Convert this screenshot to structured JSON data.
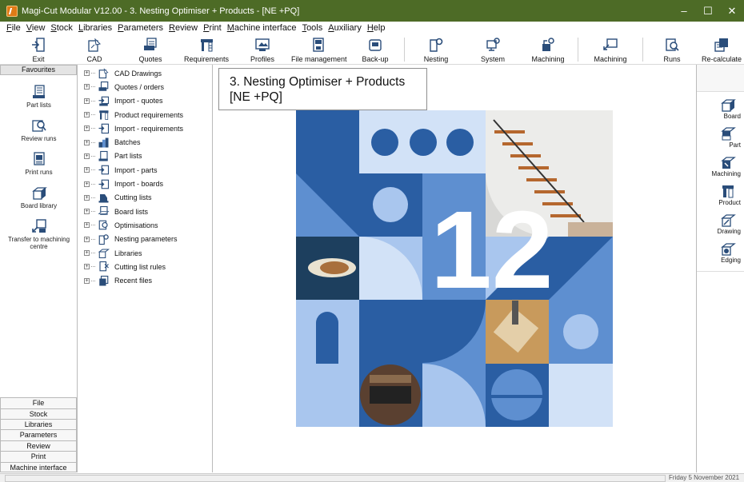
{
  "window": {
    "title": "Magi-Cut Modular V12.00 - 3. Nesting Optimiser + Products - [NE +PQ]",
    "controls": [
      "–",
      "☐",
      "✕"
    ]
  },
  "menu": [
    "File",
    "View",
    "Stock",
    "Libraries",
    "Parameters",
    "Review",
    "Print",
    "Machine interface",
    "Tools",
    "Auxiliary",
    "Help"
  ],
  "toolbar": [
    {
      "label": "Exit",
      "icon": "exit-door-icon"
    },
    {
      "label": "CAD",
      "icon": "cad-icon"
    },
    {
      "label": "Quotes",
      "icon": "quotes-icon"
    },
    {
      "label": "Requirements",
      "icon": "requirements-icon"
    },
    {
      "label": "Profiles",
      "icon": "profiles-icon"
    },
    {
      "label": "File management",
      "icon": "file-management-icon"
    },
    {
      "label": "Back-up",
      "icon": "backup-icon"
    },
    {
      "label": "Nesting",
      "icon": "nesting-icon"
    },
    {
      "label": "System",
      "icon": "system-icon"
    },
    {
      "label": "Machining",
      "icon": "machining-icon"
    },
    {
      "label": "Machining",
      "icon": "machining-icon"
    },
    {
      "label": "Runs",
      "icon": "runs-icon"
    },
    {
      "label": "Re-calculate",
      "icon": "recalculate-icon"
    }
  ],
  "favourites": {
    "header": "Favourites",
    "items": [
      {
        "label": "Part lists",
        "icon": "part-lists-icon"
      },
      {
        "label": "Review runs",
        "icon": "review-runs-icon"
      },
      {
        "label": "Print runs",
        "icon": "print-runs-icon"
      },
      {
        "label": "Board library",
        "icon": "board-library-icon"
      },
      {
        "label": "Transfer to machining centre",
        "icon": "transfer-icon"
      }
    ]
  },
  "bottom_buttons": [
    "File",
    "Stock",
    "Libraries",
    "Parameters",
    "Review",
    "Print",
    "Machine interface"
  ],
  "tree": [
    {
      "label": "CAD Drawings",
      "icon": "cad-drawings-icon"
    },
    {
      "label": "Quotes / orders",
      "icon": "quotes-orders-icon"
    },
    {
      "label": "Import - quotes",
      "icon": "import-quotes-icon"
    },
    {
      "label": "Product requirements",
      "icon": "product-requirements-icon"
    },
    {
      "label": "Import - requirements",
      "icon": "import-requirements-icon"
    },
    {
      "label": "Batches",
      "icon": "batches-icon"
    },
    {
      "label": "Part lists",
      "icon": "part-lists-icon"
    },
    {
      "label": "Import - parts",
      "icon": "import-parts-icon"
    },
    {
      "label": "Import - boards",
      "icon": "import-boards-icon"
    },
    {
      "label": "Cutting lists",
      "icon": "cutting-lists-icon"
    },
    {
      "label": "Board lists",
      "icon": "board-lists-icon"
    },
    {
      "label": "Optimisations",
      "icon": "optimisations-icon"
    },
    {
      "label": "Nesting parameters",
      "icon": "nesting-parameters-icon"
    },
    {
      "label": "Libraries",
      "icon": "libraries-icon"
    },
    {
      "label": "Cutting list rules",
      "icon": "cutting-list-rules-icon"
    },
    {
      "label": "Recent files",
      "icon": "recent-files-icon"
    }
  ],
  "main": {
    "title": "3. Nesting Optimiser + Products\n[NE +PQ]",
    "splash_number": "12"
  },
  "right_panel": [
    {
      "label": "Board",
      "icon": "board-icon"
    },
    {
      "label": "Part",
      "icon": "part-icon"
    },
    {
      "label": "Machining",
      "icon": "machining-icon"
    },
    {
      "label": "Product",
      "icon": "product-icon"
    },
    {
      "label": "Drawing",
      "icon": "drawing-icon"
    },
    {
      "label": "Edging",
      "icon": "edging-icon"
    }
  ],
  "status": {
    "date": "Friday 5 November 2021"
  },
  "colors": {
    "title_bar": "#4d6b26",
    "navy": "#2a5ea3",
    "mid_blue": "#5e8fd0",
    "light_blue": "#a9c6ee",
    "pale_blue": "#d2e2f7"
  }
}
